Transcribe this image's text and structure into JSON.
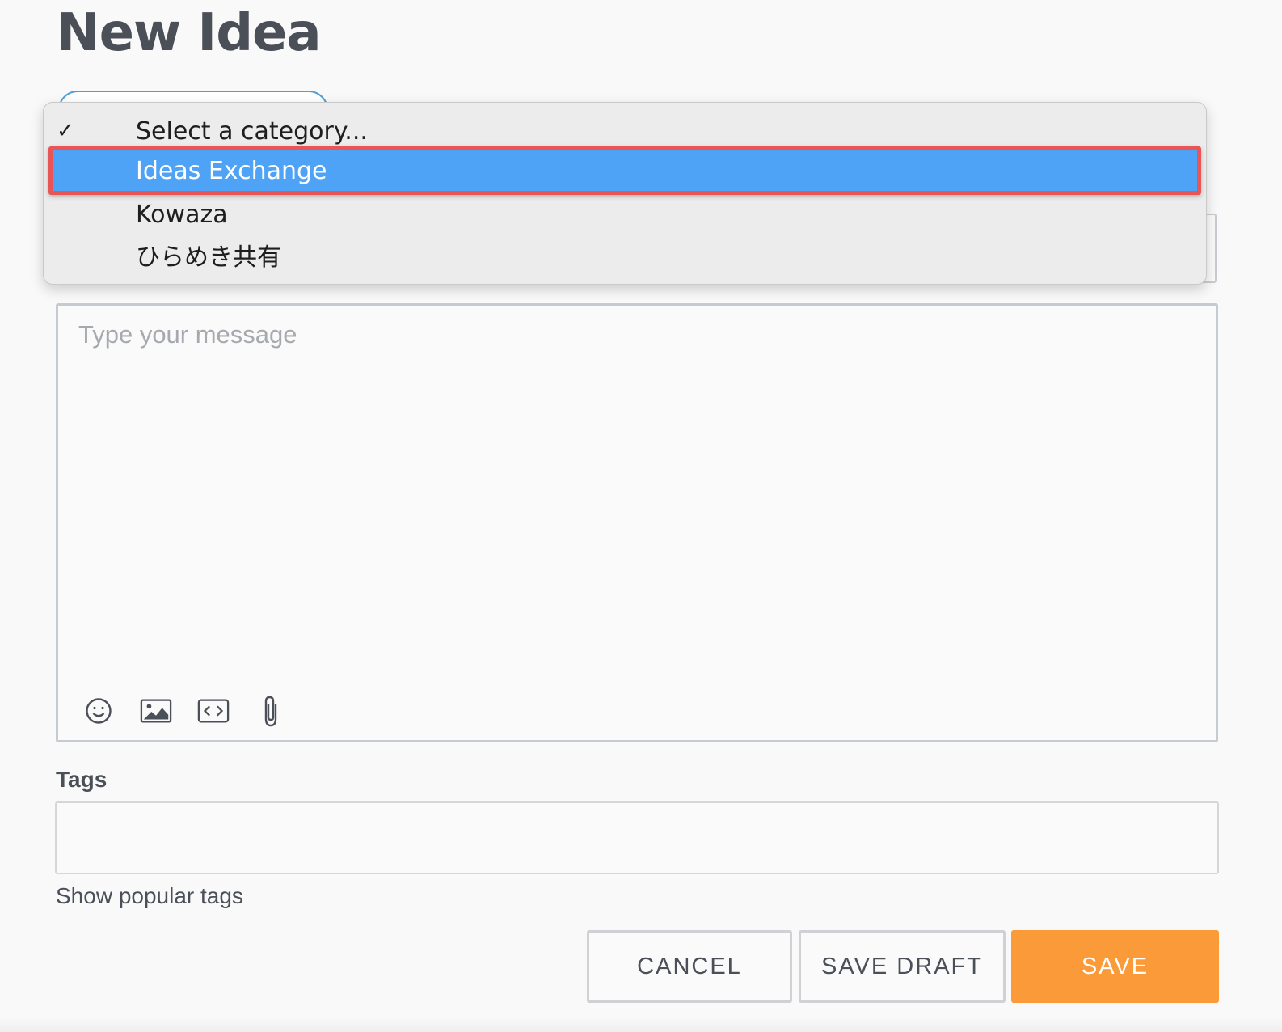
{
  "page": {
    "title": "New Idea"
  },
  "category_dropdown": {
    "placeholder_check": "✓",
    "placeholder": "Select a category...",
    "options": [
      {
        "label": "Ideas Exchange",
        "highlighted": true
      },
      {
        "label": "Kowaza",
        "highlighted": false
      },
      {
        "label": "ひらめき共有",
        "highlighted": false
      }
    ]
  },
  "message": {
    "placeholder": "Type your message",
    "toolbar": [
      {
        "icon": "smiley-icon",
        "action": "emoji"
      },
      {
        "icon": "image-icon",
        "action": "insert-image"
      },
      {
        "icon": "code-icon",
        "action": "insert-code"
      },
      {
        "icon": "paperclip-icon",
        "action": "attach-file"
      }
    ]
  },
  "tags": {
    "label": "Tags",
    "value": "",
    "show_popular": "Show popular tags"
  },
  "actions": {
    "cancel": "CANCEL",
    "save_draft": "SAVE DRAFT",
    "save": "SAVE"
  },
  "colors": {
    "accent_orange": "#fb9a38",
    "highlight_blue": "#4fa3f7",
    "annotation_red": "#e95555",
    "text_dark": "#4a4f58"
  }
}
